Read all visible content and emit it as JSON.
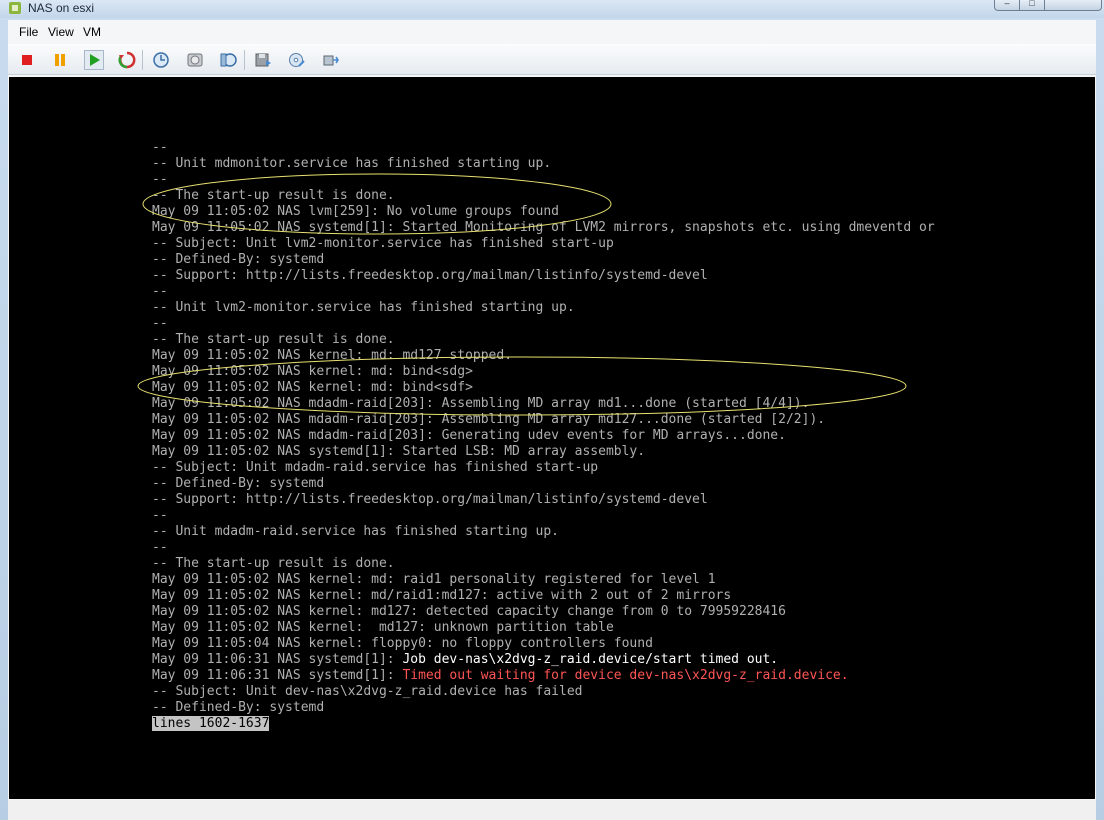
{
  "window": {
    "title": "NAS on esxi"
  },
  "menu": [
    {
      "label": "File"
    },
    {
      "label": "View"
    },
    {
      "label": "VM"
    }
  ],
  "toolbar": [
    {
      "icon": "stop-icon",
      "color": "#e02020"
    },
    {
      "icon": "pause-icon",
      "color": "#f0a000"
    },
    {
      "icon": "play-icon",
      "color": "#20a020"
    },
    {
      "icon": "reset-icon",
      "color": "#d03030"
    },
    {
      "icon": "snapshot-icon"
    },
    {
      "icon": "revert-snapshot-icon"
    },
    {
      "icon": "snapshot-manager-icon"
    },
    {
      "icon": "floppy-icon"
    },
    {
      "icon": "cd-dvd-icon"
    },
    {
      "icon": "network-adapter-icon"
    }
  ],
  "console": {
    "lines": [
      {
        "text": "--",
        "style": "normal"
      },
      {
        "text": "-- Unit mdmonitor.service has finished starting up.",
        "style": "normal"
      },
      {
        "text": "--",
        "style": "normal"
      },
      {
        "text": "-- The start-up result is done.",
        "style": "normal"
      },
      {
        "text": "May 09 11:05:02 NAS lvm[259]: No volume groups found",
        "style": "normal"
      },
      {
        "text": "May 09 11:05:02 NAS systemd[1]: Started Monitoring of LVM2 mirrors, snapshots etc. using dmeventd or",
        "style": "normal"
      },
      {
        "text": "-- Subject: Unit lvm2-monitor.service has finished start-up",
        "style": "normal"
      },
      {
        "text": "-- Defined-By: systemd",
        "style": "normal"
      },
      {
        "text": "-- Support: http://lists.freedesktop.org/mailman/listinfo/systemd-devel",
        "style": "normal"
      },
      {
        "text": "--",
        "style": "normal"
      },
      {
        "text": "-- Unit lvm2-monitor.service has finished starting up.",
        "style": "normal"
      },
      {
        "text": "--",
        "style": "normal"
      },
      {
        "text": "-- The start-up result is done.",
        "style": "normal"
      },
      {
        "text": "May 09 11:05:02 NAS kernel: md: md127 stopped.",
        "style": "normal"
      },
      {
        "text": "May 09 11:05:02 NAS kernel: md: bind<sdg>",
        "style": "normal"
      },
      {
        "text": "May 09 11:05:02 NAS kernel: md: bind<sdf>",
        "style": "normal"
      },
      {
        "text": "May 09 11:05:02 NAS mdadm-raid[203]: Assembling MD array md1...done (started [4/4]).",
        "style": "normal"
      },
      {
        "text": "May 09 11:05:02 NAS mdadm-raid[203]: Assembling MD array md127...done (started [2/2]).",
        "style": "normal"
      },
      {
        "text": "May 09 11:05:02 NAS mdadm-raid[203]: Generating udev events for MD arrays...done.",
        "style": "normal"
      },
      {
        "text": "May 09 11:05:02 NAS systemd[1]: Started LSB: MD array assembly.",
        "style": "normal"
      },
      {
        "text": "-- Subject: Unit mdadm-raid.service has finished start-up",
        "style": "normal"
      },
      {
        "text": "-- Defined-By: systemd",
        "style": "normal"
      },
      {
        "text": "-- Support: http://lists.freedesktop.org/mailman/listinfo/systemd-devel",
        "style": "normal"
      },
      {
        "text": "--",
        "style": "normal"
      },
      {
        "text": "-- Unit mdadm-raid.service has finished starting up.",
        "style": "normal"
      },
      {
        "text": "--",
        "style": "normal"
      },
      {
        "text": "-- The start-up result is done.",
        "style": "normal"
      },
      {
        "text": "May 09 11:05:02 NAS kernel: md: raid1 personality registered for level 1",
        "style": "normal"
      },
      {
        "text": "May 09 11:05:02 NAS kernel: md/raid1:md127: active with 2 out of 2 mirrors",
        "style": "normal"
      },
      {
        "text": "May 09 11:05:02 NAS kernel: md127: detected capacity change from 0 to 79959228416",
        "style": "normal"
      },
      {
        "text": "May 09 11:05:02 NAS kernel:  md127: unknown partition table",
        "style": "normal"
      },
      {
        "text": "May 09 11:05:04 NAS kernel: floppy0: no floppy controllers found",
        "style": "normal"
      },
      {
        "prefix": "May 09 11:06:31 NAS systemd[1]: ",
        "text": "Job dev-nas\\x2dvg-z_raid.device/start timed out.",
        "style": "bright"
      },
      {
        "prefix": "May 09 11:06:31 NAS systemd[1]: ",
        "text": "Timed out waiting for device dev-nas\\x2dvg-z_raid.device.",
        "style": "red"
      },
      {
        "text": "-- Subject: Unit dev-nas\\x2dvg-z_raid.device has failed",
        "style": "normal"
      },
      {
        "text": "-- Defined-By: systemd",
        "style": "normal"
      }
    ],
    "pager_status": "lines 1602-1637",
    "text_color": "#b0b0b0",
    "highlight_color": "#ffffff",
    "error_color": "#ff5555",
    "annotation_color": "#e8e070"
  }
}
